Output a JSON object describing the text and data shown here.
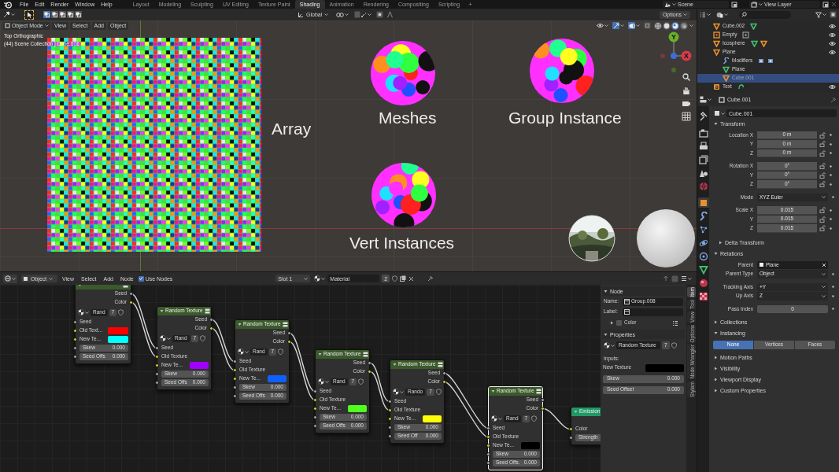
{
  "topbar": {
    "menus": [
      "File",
      "Edit",
      "Render",
      "Window",
      "Help"
    ],
    "workspaces": [
      {
        "label": "Layout",
        "selected": false
      },
      {
        "label": "Modeling",
        "selected": false
      },
      {
        "label": "Sculpting",
        "selected": false
      },
      {
        "label": "UV Editing",
        "selected": false
      },
      {
        "label": "Texture Paint",
        "selected": false
      },
      {
        "label": "Shading",
        "selected": true
      },
      {
        "label": "Animation",
        "selected": false
      },
      {
        "label": "Rendering",
        "selected": false
      },
      {
        "label": "Compositing",
        "selected": false
      },
      {
        "label": "Scripting",
        "selected": false
      }
    ],
    "add_tab": "+",
    "scene": "Scene",
    "view_layer": "View Layer"
  },
  "tool_header": {
    "select_modes": [
      {
        "selected": true
      },
      {
        "selected": false
      },
      {
        "selected": false
      },
      {
        "selected": false
      },
      {
        "selected": false
      }
    ],
    "orientation": "Global",
    "options": "Options"
  },
  "viewport": {
    "mode": "Object Mode",
    "menus": [
      "View",
      "Select",
      "Add",
      "Object"
    ],
    "gizmos_on": true,
    "overlays_on": true,
    "shading_modes": [
      {
        "selected": false
      },
      {
        "selected": false
      },
      {
        "selected": true
      },
      {
        "selected": false
      }
    ],
    "view_name": "Top Orthographic",
    "collection_info": "(44) Scene Collection | Cube.001",
    "gizmo_axes": [
      "Y",
      "X"
    ],
    "labels": [
      "Array",
      "Meshes",
      "Group Instance",
      "Vert Instances"
    ]
  },
  "node_editor": {
    "header": {
      "object": "Object",
      "menus": [
        "View",
        "Select",
        "Add",
        "Node"
      ],
      "use_nodes": {
        "label": "Use Nodes",
        "checked": true
      },
      "slot": "Slot 1",
      "material": "Material",
      "users": "2"
    },
    "nodes": [
      {
        "kind": "random_texture",
        "selected": false,
        "outputs": [
          {
            "label": "Seed",
            "color_socket": false
          },
          {
            "label": "Color",
            "color_socket": true
          }
        ],
        "group": "Rand",
        "users": "7",
        "inputs": [
          {
            "kind": "label",
            "color_socket": false,
            "label": "Seed"
          },
          {
            "kind": "swatch",
            "color_socket": true,
            "label": "Old Text...",
            "color": "#ff0000"
          },
          {
            "kind": "swatch",
            "color_socket": true,
            "label": "New Te...",
            "color": "#00ffff"
          },
          {
            "kind": "slider",
            "color_socket": false,
            "label": "Skew",
            "value": "0.000"
          },
          {
            "kind": "slider",
            "color_socket": false,
            "label": "Seed Offs",
            "value": "0.000"
          }
        ]
      },
      {
        "kind": "random_texture",
        "title": "Random Texture",
        "selected": false,
        "outputs": [
          {
            "label": "Seed",
            "color_socket": false
          },
          {
            "label": "Color",
            "color_socket": true
          }
        ],
        "group": "Rand",
        "users": "7",
        "inputs": [
          {
            "kind": "label",
            "color_socket": false,
            "label": "Seed"
          },
          {
            "kind": "label",
            "color_socket": true,
            "label": "Old Texture"
          },
          {
            "kind": "swatch",
            "color_socket": true,
            "label": "New Te...",
            "color": "#a000ff"
          },
          {
            "kind": "slider",
            "color_socket": false,
            "label": "Skew",
            "value": "0.000"
          },
          {
            "kind": "slider",
            "color_socket": false,
            "label": "Seed Offs",
            "value": "0.000"
          }
        ]
      },
      {
        "kind": "random_texture",
        "title": "Random Texture",
        "selected": false,
        "outputs": [
          {
            "label": "Seed",
            "color_socket": false
          },
          {
            "label": "Color",
            "color_socket": true
          }
        ],
        "group": "Rand",
        "users": "7",
        "inputs": [
          {
            "kind": "label",
            "color_socket": false,
            "label": "Seed"
          },
          {
            "kind": "label",
            "color_socket": true,
            "label": "Old Texture"
          },
          {
            "kind": "swatch",
            "color_socket": true,
            "label": "New Te...",
            "color": "#1060ff"
          },
          {
            "kind": "slider",
            "color_socket": false,
            "label": "Skew",
            "value": "0.000"
          },
          {
            "kind": "slider",
            "color_socket": false,
            "label": "Seed Offs",
            "value": "0.000"
          }
        ]
      },
      {
        "kind": "random_texture",
        "title": "Random Texture",
        "selected": false,
        "outputs": [
          {
            "label": "Seed",
            "color_socket": false
          },
          {
            "label": "Color",
            "color_socket": true
          }
        ],
        "group": "Rand",
        "users": "7",
        "inputs": [
          {
            "kind": "label",
            "color_socket": false,
            "label": "Seed"
          },
          {
            "kind": "label",
            "color_socket": true,
            "label": "Old Texture"
          },
          {
            "kind": "swatch",
            "color_socket": true,
            "label": "New Te...",
            "color": "#50ff20"
          },
          {
            "kind": "slider",
            "color_socket": false,
            "label": "Skew",
            "value": "0.000"
          },
          {
            "kind": "slider",
            "color_socket": false,
            "label": "Seed Offs",
            "value": "0.000"
          }
        ]
      },
      {
        "kind": "random_texture",
        "title": "Random Texture",
        "selected": false,
        "outputs": [
          {
            "label": "Seed",
            "color_socket": false
          },
          {
            "label": "Color",
            "color_socket": true
          }
        ],
        "group": "Rando",
        "users": "7",
        "inputs": [
          {
            "kind": "label",
            "color_socket": false,
            "label": "Seed"
          },
          {
            "kind": "label",
            "color_socket": true,
            "label": "Old Texture"
          },
          {
            "kind": "swatch",
            "color_socket": true,
            "label": "New Te...",
            "color": "#ffff00"
          },
          {
            "kind": "slider",
            "color_socket": false,
            "label": "Skew",
            "value": "0.000"
          },
          {
            "kind": "slider",
            "color_socket": false,
            "label": "Seed Off",
            "value": "0.000"
          }
        ]
      },
      {
        "kind": "random_texture",
        "title": "Random Texture",
        "selected": true,
        "outputs": [
          {
            "label": "Seed",
            "color_socket": false
          },
          {
            "label": "Color",
            "color_socket": true
          }
        ],
        "group": "Rand",
        "users": "7",
        "inputs": [
          {
            "kind": "label",
            "color_socket": false,
            "label": "Seed"
          },
          {
            "kind": "label",
            "color_socket": true,
            "label": "Old Texture"
          },
          {
            "kind": "swatch",
            "color_socket": true,
            "label": "New Te...",
            "color": "#000000"
          },
          {
            "kind": "slider",
            "color_socket": false,
            "label": "Skew",
            "value": "0.000"
          },
          {
            "kind": "slider",
            "color_socket": false,
            "label": "Seed Offs.",
            "value": "0.000"
          }
        ]
      },
      {
        "kind": "emission",
        "title": "Emission",
        "selected": false,
        "inputs": [
          {
            "kind": "label",
            "color_socket": true,
            "label": "Color"
          },
          {
            "kind": "field",
            "color_socket": false,
            "label": "Strength"
          }
        ]
      }
    ],
    "sidebar": {
      "tabs": [
        {
          "label": "Item",
          "selected": true
        },
        {
          "label": "Tool",
          "selected": false
        },
        {
          "label": "View",
          "selected": false
        },
        {
          "label": "Options",
          "selected": false
        },
        {
          "label": "Node Wrangler",
          "selected": false
        },
        {
          "label": "Stylam",
          "selected": false
        }
      ],
      "node_panel": {
        "title": "Node",
        "name_label": "Name:",
        "name": "Group.008",
        "label_label": "Label:",
        "color_label": "Color",
        "color_enabled": false
      },
      "properties_panel": {
        "title": "Properties",
        "group": "Random Texture",
        "users": "7",
        "inputs_title": "Inputs:",
        "inputs": [
          {
            "kind": "swatch",
            "label": "New Texture",
            "color": "#000000"
          },
          {
            "kind": "slider",
            "label": "Skew",
            "value": "0.000"
          },
          {
            "kind": "slider",
            "label": "Seed Offset",
            "value": "0.000"
          }
        ]
      }
    }
  },
  "outliner": {
    "rows": [
      {
        "name": "Cube.002",
        "kind": "mesh",
        "extras": [
          {
            "kind": "mesh_data"
          }
        ],
        "visible": true,
        "selected": false
      },
      {
        "name": "Empty",
        "kind": "empty",
        "extras": [
          {
            "kind": "frame"
          }
        ],
        "visible": true,
        "selected": false
      },
      {
        "name": "Icosphere",
        "kind": "mesh",
        "extras": [
          {
            "kind": "mesh_data"
          },
          {
            "kind": "mesh"
          }
        ],
        "visible": true,
        "selected": false
      },
      {
        "name": "Plane",
        "kind": "mesh",
        "visible": true,
        "selected": false,
        "children": [
          {
            "name": "Modifiers",
            "kind": "modifiers",
            "extras": [
              {
                "kind": "modifier"
              },
              {
                "kind": "modifier"
              }
            ],
            "visible": false,
            "selected": false
          },
          {
            "name": "Plane",
            "kind": "mesh_data",
            "visible": false,
            "selected": false
          },
          {
            "name": "Cube.001",
            "kind": "mesh",
            "visible": false,
            "selected": true
          }
        ]
      },
      {
        "name": "Text",
        "kind": "text",
        "extras": [
          {
            "kind": "curve"
          }
        ],
        "visible": true,
        "selected": false
      }
    ]
  },
  "properties": {
    "tabs": [
      {
        "kind": "tool",
        "selected": false
      },
      {
        "kind": "render",
        "selected": false
      },
      {
        "kind": "output",
        "selected": false
      },
      {
        "kind": "view_layer",
        "selected": false
      },
      {
        "kind": "scene",
        "selected": false
      },
      {
        "kind": "world",
        "selected": false
      },
      {
        "kind": "object",
        "selected": true
      },
      {
        "kind": "modifiers",
        "selected": false
      },
      {
        "kind": "particles",
        "selected": false
      },
      {
        "kind": "physics",
        "selected": false
      },
      {
        "kind": "constraints",
        "selected": false
      },
      {
        "kind": "data",
        "selected": false
      },
      {
        "kind": "material",
        "selected": false
      },
      {
        "kind": "texture",
        "selected": false
      }
    ],
    "context": "Cube.001",
    "object_name": "Cube.001",
    "panels": [
      {
        "kind": "panel",
        "title": "Transform",
        "expanded": true,
        "groups": [
          [
            {
              "kind": "lockable",
              "label": "Location X",
              "value": "0 m"
            },
            {
              "kind": "lockable",
              "label": "Y",
              "value": "0 m"
            },
            {
              "kind": "lockable",
              "label": "Z",
              "value": "0 m"
            }
          ],
          [
            {
              "kind": "lockable",
              "label": "Rotation X",
              "value": "0°"
            },
            {
              "kind": "lockable",
              "label": "Y",
              "value": "0°"
            },
            {
              "kind": "lockable",
              "label": "Z",
              "value": "0°"
            }
          ],
          [
            {
              "kind": "dropdown",
              "label": "Mode",
              "value": "XYZ Euler"
            }
          ],
          [
            {
              "kind": "lockable",
              "label": "Scale X",
              "value": "0.015"
            },
            {
              "kind": "lockable",
              "label": "Y",
              "value": "0.015"
            },
            {
              "kind": "lockable",
              "label": "Z",
              "value": "0.015"
            }
          ]
        ]
      },
      {
        "kind": "subpanel",
        "title": "Delta Transform",
        "expanded": false
      },
      {
        "kind": "panel",
        "title": "Relations",
        "expanded": true,
        "groups": [
          [
            {
              "kind": "object",
              "label": "Parent",
              "value": "Plane"
            },
            {
              "kind": "dropdown",
              "label": "Parent Type",
              "value": "Object"
            }
          ],
          [
            {
              "kind": "dropdown",
              "label": "Tracking Axis",
              "value": "+Y"
            },
            {
              "kind": "dropdown",
              "label": "Up Axis",
              "value": "Z"
            }
          ],
          [
            {
              "kind": "number",
              "label": "Pass Index",
              "value": "0"
            }
          ]
        ]
      },
      {
        "kind": "panel",
        "title": "Collections",
        "expanded": false
      },
      {
        "kind": "panel",
        "title": "Instancing",
        "expanded": true,
        "options": [
          {
            "label": "None",
            "selected": true
          },
          {
            "label": "Vertices",
            "selected": false
          },
          {
            "label": "Faces",
            "selected": false
          }
        ]
      },
      {
        "kind": "panel",
        "title": "Motion Paths",
        "expanded": false
      },
      {
        "kind": "panel",
        "title": "Visibility",
        "expanded": false
      },
      {
        "kind": "panel",
        "title": "Viewport Display",
        "expanded": false
      },
      {
        "kind": "panel",
        "title": "Custom Properties",
        "expanded": false
      }
    ]
  }
}
